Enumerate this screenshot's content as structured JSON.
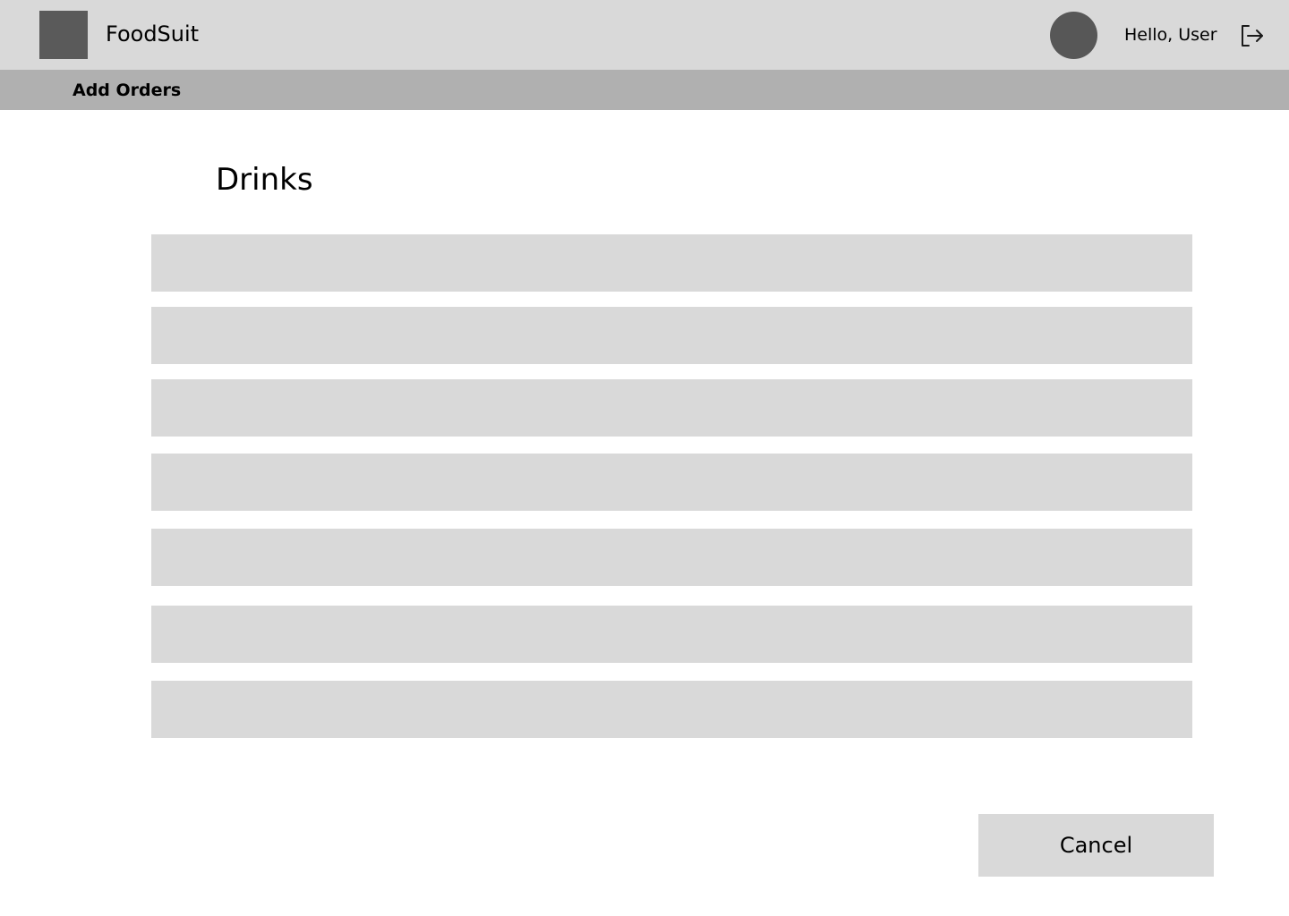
{
  "header": {
    "app_title": "FoodSuit",
    "greeting": "Hello, User",
    "logo_icon": "app-logo-placeholder",
    "avatar_icon": "user-avatar",
    "logout_icon": "logout-icon"
  },
  "subnav": {
    "items": [
      {
        "label": "Add Orders"
      }
    ]
  },
  "main": {
    "section_title": "Drinks",
    "rows": [
      {
        "label": ""
      },
      {
        "label": ""
      },
      {
        "label": ""
      },
      {
        "label": ""
      },
      {
        "label": ""
      },
      {
        "label": ""
      },
      {
        "label": ""
      }
    ],
    "cancel_label": "Cancel"
  },
  "colors": {
    "header_bg": "#d9d9d9",
    "subnav_bg": "#b0b0b0",
    "row_bg": "#d9d9d9",
    "logo": "#5a5a5a",
    "avatar": "#575757"
  }
}
